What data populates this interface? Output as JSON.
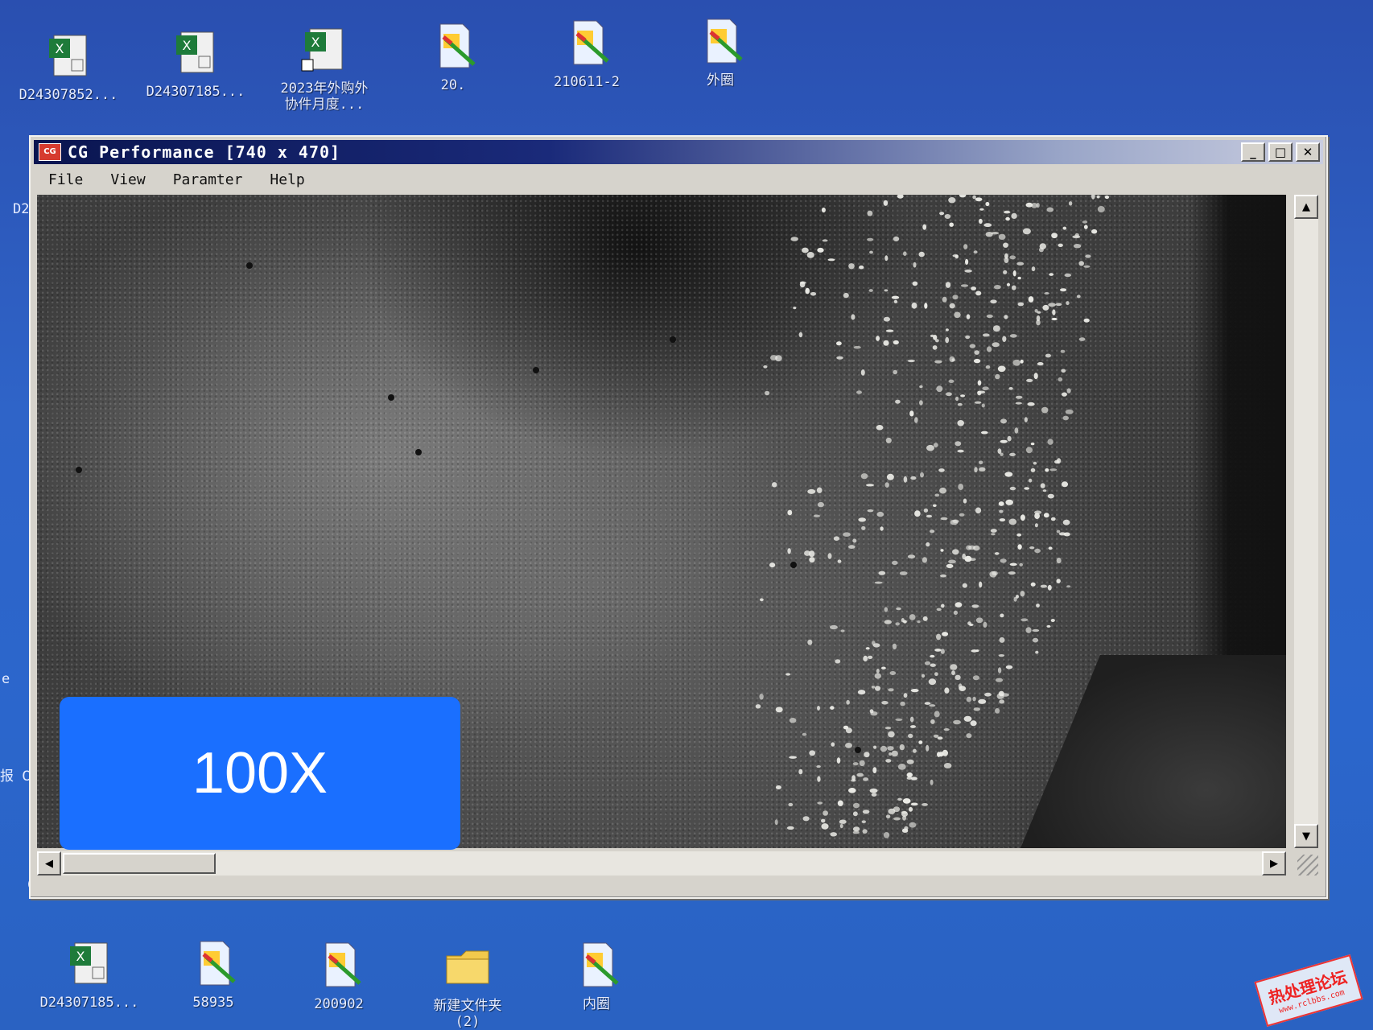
{
  "desktop": {
    "top_icons": [
      {
        "label": "D24307852...",
        "icon": "excel-file-icon"
      },
      {
        "label": "D24307185...",
        "icon": "excel-file-icon"
      },
      {
        "label": "2023年外购外\n协件月度...",
        "icon": "excel-shortcut-icon"
      },
      {
        "label": "20.",
        "icon": "paint-image-icon"
      },
      {
        "label": "210611-2",
        "icon": "paint-image-icon"
      },
      {
        "label": "外圈",
        "icon": "paint-image-icon"
      }
    ],
    "bottom_icons": [
      {
        "label": "D24307185...",
        "icon": "excel-file-icon"
      },
      {
        "label": "58935",
        "icon": "paint-image-icon"
      },
      {
        "label": "200902",
        "icon": "paint-image-icon"
      },
      {
        "label": "新建文件夹\n(2)",
        "icon": "folder-icon"
      },
      {
        "label": "内圈",
        "icon": "paint-image-icon"
      }
    ],
    "left_clipped": [
      "D2",
      "e",
      "报 C(",
      "C("
    ]
  },
  "window": {
    "title": "CG Performance [740 x 470]",
    "app_icon_text": "CG",
    "buttons": {
      "minimize": "_",
      "maximize": "□",
      "close": "✕"
    },
    "menu": [
      "File",
      "View",
      "Paramter",
      "Help"
    ]
  },
  "overlay": {
    "magnification": "100X",
    "color": "#1a6fff"
  },
  "watermark": {
    "line1": "热处理论坛",
    "line2": "www.rclbbs.com"
  }
}
